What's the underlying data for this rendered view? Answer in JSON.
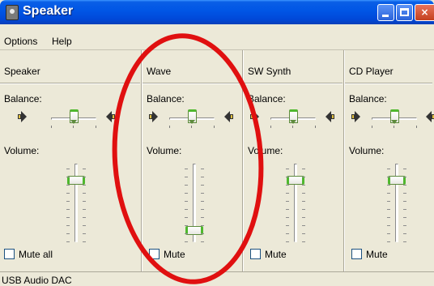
{
  "window": {
    "title": "Speaker",
    "buttons": {
      "minimize": "minimize",
      "maximize": "maximize",
      "close": "×"
    }
  },
  "menu": [
    "Options",
    "Help"
  ],
  "channels": [
    {
      "name": "Speaker",
      "balance_label": "Balance:",
      "volume_label": "Volume:",
      "balance": 0.5,
      "volume": 0.85,
      "mute_label": "Mute all",
      "muted": false
    },
    {
      "name": "Wave",
      "balance_label": "Balance:",
      "volume_label": "Volume:",
      "balance": 0.5,
      "volume": 0.15,
      "mute_label": "Mute",
      "muted": false
    },
    {
      "name": "SW Synth",
      "balance_label": "Balance:",
      "volume_label": "Volume:",
      "balance": 0.5,
      "volume": 0.85,
      "mute_label": "Mute",
      "muted": false
    },
    {
      "name": "CD Player",
      "balance_label": "Balance:",
      "volume_label": "Volume:",
      "balance": 0.5,
      "volume": 0.85,
      "mute_label": "Mute",
      "muted": false
    }
  ],
  "status": "USB Audio DAC",
  "colors": {
    "titlebar": "#0055e5",
    "thumb_accent": "#4fb82e",
    "annotation": "#e01010",
    "window_bg": "#ece9d8"
  },
  "annotation": {
    "shape": "ellipse",
    "color": "#e01010",
    "encloses": "Wave"
  }
}
